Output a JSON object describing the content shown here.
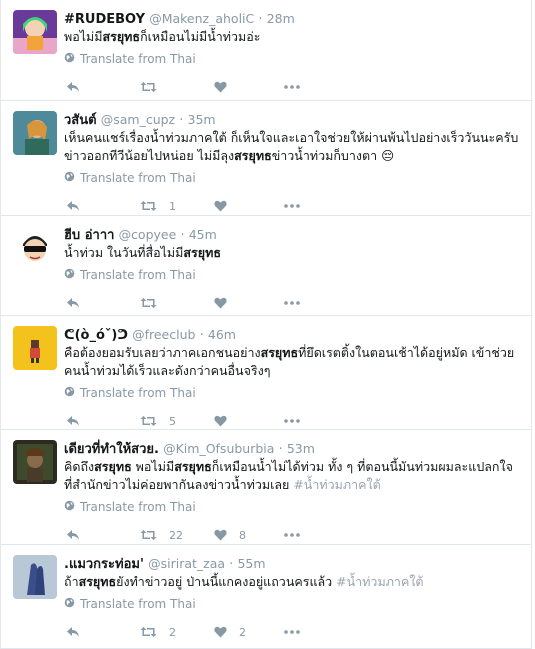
{
  "translate_label": "Translate from Thai",
  "tweets": [
    {
      "name": "#RUDEBOY",
      "handle": "@Makenz_aholiC",
      "time": "28m",
      "text_parts": [
        {
          "t": "พอไม่มี"
        },
        {
          "t": "สรยุทธ",
          "hl": true
        },
        {
          "t": "ก็เหมือนไม่มีน้ำท่วมอ่ะ"
        }
      ],
      "retweets": "",
      "likes": ""
    },
    {
      "name": "วสันต์",
      "handle": "@sam_cupz",
      "time": "35m",
      "text_parts": [
        {
          "t": "เห็นคนแชร์เรื่องน้ำท่วมภาคใต้ ก็เห็นใจและเอาใจช่วยให้ผ่านพ้นไปอย่างเร็ววันนะครับ ข่าวออกทีวีน้อยไปหน่อย ไม่มีลุง"
        },
        {
          "t": "สรยุทธ",
          "hl": true
        },
        {
          "t": "ข่าวน้ำท่วมก็บางตา 😔"
        }
      ],
      "retweets": "1",
      "likes": ""
    },
    {
      "name": "ฮีบ อ่าาา",
      "handle": "@copyee",
      "time": "45m",
      "text_parts": [
        {
          "t": "น้ำท่วม ในวันที่สื่อไม่มี"
        },
        {
          "t": "สรยุทธ",
          "hl": true
        }
      ],
      "retweets": "",
      "likes": ""
    },
    {
      "name": "ᕦ(ò_óˇ)ᕤ",
      "handle": "@freeclub",
      "time": "46m",
      "text_parts": [
        {
          "t": "คือต้องยอมรับเลยว่าภาคเอกชนอย่าง"
        },
        {
          "t": "สรยุทธ",
          "hl": true
        },
        {
          "t": "ที่ยึดเรตติ้งในตอนเช้าได้อยู่หมัด เข้าช่วยคนน้ำท่วมได้เร็วและดังกว่าคนอื่นจริงๆ"
        }
      ],
      "retweets": "5",
      "likes": ""
    },
    {
      "name": "เดียวที่ทำให้สวย.",
      "handle": "@Kim_Ofsuburbia",
      "time": "53m",
      "text_parts": [
        {
          "t": "คิดถึง"
        },
        {
          "t": "สรยุทธ",
          "hl": true
        },
        {
          "t": " พอไม่มี"
        },
        {
          "t": "สรยุทธ",
          "hl": true
        },
        {
          "t": "ก็เหมือนน้ำไม่ได้ท่วม ทั้ง ๆ ที่ตอนนี้มันท่วมผมละแปลกใจที่สำนักข่าวไม่ค่อยพากันลงข่าวน้ำท่วมเลย "
        },
        {
          "t": "#น้ำท่วมภาคใต้",
          "tag": true
        }
      ],
      "retweets": "22",
      "likes": "8"
    },
    {
      "name": ".แมวกระท่อม'",
      "handle": "@sirirat_zaa",
      "time": "55m",
      "text_parts": [
        {
          "t": "ถ้า"
        },
        {
          "t": "สรยุทธ",
          "hl": true
        },
        {
          "t": "ยังทำข่าวอยู่ ป่านนี้แกคงอยู่แถวนครแล้ว "
        },
        {
          "t": "#น้ำท่วมภาคใต้",
          "tag": true
        }
      ],
      "retweets": "2",
      "likes": "2"
    }
  ]
}
